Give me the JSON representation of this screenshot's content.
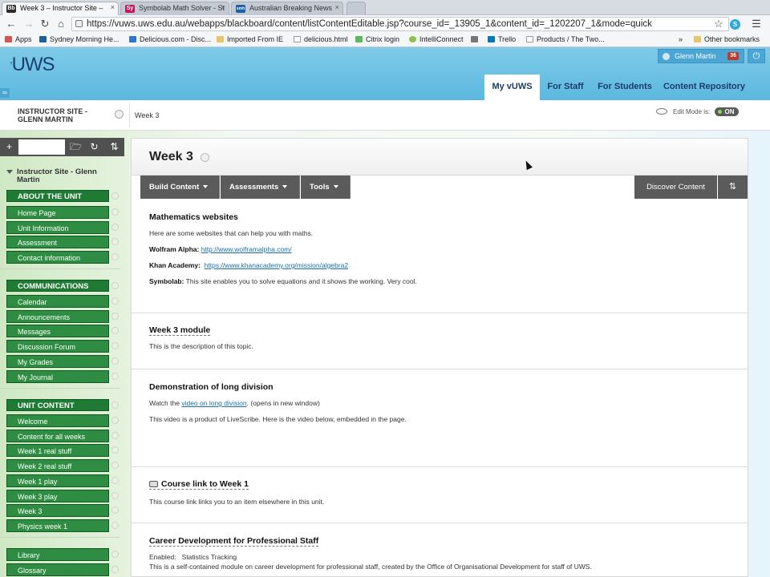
{
  "browser": {
    "tabs": [
      {
        "title": "Week 3 – Instructor Site –",
        "icon": "blackboard-icon",
        "color": "#2b2b2b",
        "glyph": "Bb"
      },
      {
        "title": "Symbolab Math Solver - St",
        "icon": "symbolab-icon",
        "color": "#c2185b",
        "glyph": "Sy"
      },
      {
        "title": "Australian Breaking News",
        "icon": "smh-icon",
        "color": "#1d5fa0",
        "glyph": "smh"
      }
    ],
    "url": "https://vuws.uws.edu.au/webapps/blackboard/content/listContentEditable.jsp?course_id=_13905_1&content_id=_1202207_1&mode=quick",
    "bookmarks": [
      "Apps",
      "Sydney Morning He...",
      "Delicious.com - Disc...",
      "Imported From IE",
      "delicious.html",
      "Citrix login",
      "IntelliConnect",
      "Trello",
      "Products / The Two..."
    ],
    "bookmarks_more": "»",
    "other_bookmarks": "Other bookmarks"
  },
  "header": {
    "logo": "UWS",
    "user_name": "Glenn Martin",
    "notification_count": "36",
    "tabs": [
      "My vUWS",
      "For Staff",
      "For Students",
      "Content Repository"
    ]
  },
  "breadcrumb": {
    "site": "INSTRUCTOR SITE - GLENN MARTIN",
    "current": "Week 3",
    "edit_mode_label": "Edit Mode is:",
    "edit_mode_state": "ON"
  },
  "sidebar": {
    "site_title": "Instructor Site - Glenn Martin",
    "sections": [
      {
        "title": "ABOUT THE UNIT",
        "items": [
          "Home Page",
          "Unit Information",
          "Assessment",
          "Contact information"
        ]
      },
      {
        "title": "COMMUNICATIONS",
        "items": [
          "Calendar",
          "Announcements",
          "Messages",
          "Discussion Forum",
          "My Grades",
          "My Journal"
        ]
      },
      {
        "title": "UNIT CONTENT",
        "items": [
          "Welcome",
          "Content for all weeks",
          "Week 1 real stuff",
          "Week 2 real stuff",
          "Week 1 play",
          "Week 3 play",
          "Week 3",
          "Physics week 1"
        ]
      },
      {
        "title": "",
        "items": [
          "Library",
          "Glossary"
        ]
      }
    ]
  },
  "page": {
    "title": "Week 3",
    "actions": [
      "Build Content",
      "Assessments",
      "Tools"
    ],
    "discover": "Discover Content",
    "items": [
      {
        "title": "Mathematics websites",
        "intro": "Here are some websites that can help you with maths.",
        "links": [
          {
            "label": "Wolfram Alpha:",
            "url": "http://www.wolframalpha.com/"
          },
          {
            "label": "Khan Academy:",
            "url": "https://www.khanacademy.org/mission/algebra2"
          }
        ],
        "symbolab_label": "Symbolab:",
        "symbolab_text": "This site enables you to solve equations and it shows the working. Very cool."
      },
      {
        "title": "Week 3 module",
        "text": "This is the description of this topic."
      },
      {
        "title": "Demonstration of long division",
        "watch_prefix": "Watch the",
        "watch_link": "video on long division",
        "watch_suffix": ". (opens in new window)",
        "text": "This video is a product of LiveScribe. Here is the video below, embedded in the page."
      },
      {
        "title": "Course link to Week 1",
        "text": "This course link links you to an item elsewhere in this unit."
      },
      {
        "title": "Career Development for Professional Staff",
        "enabled_label": "Enabled:",
        "enabled_value": "Statistics Tracking",
        "text": "This is a self-contained module on career development for professional staff, created by the Office of Organisational Development for staff of UWS."
      }
    ]
  }
}
